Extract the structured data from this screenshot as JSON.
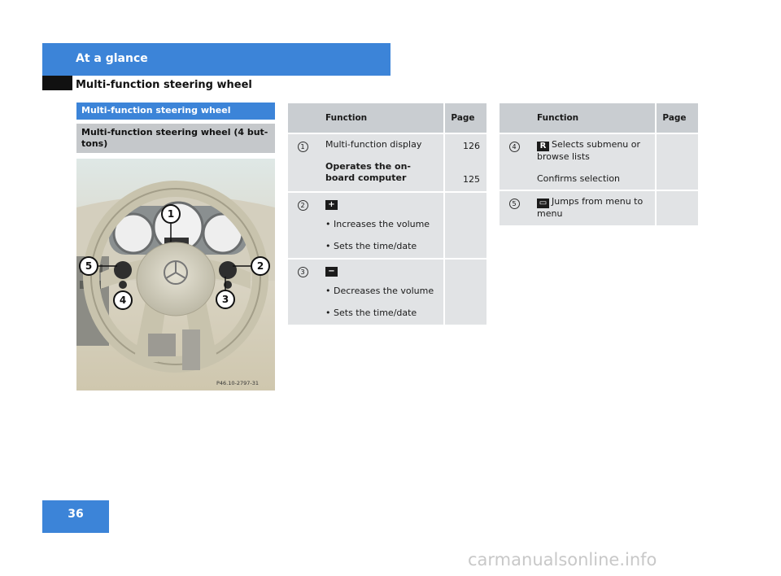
{
  "header": {
    "section": "At a glance",
    "subtitle": "Multi-function steering wheel"
  },
  "left": {
    "section_bar": "Multi-function steering wheel",
    "sub_bar": "Multi-function steering wheel (4 buttons)",
    "photo_code": "P46.10-2797-31",
    "callouts": [
      "1",
      "2",
      "3",
      "4",
      "5"
    ]
  },
  "table_headers": {
    "function": "Function",
    "page": "Page"
  },
  "table1": {
    "rows": [
      {
        "num": "1",
        "lines": [
          "Multi-function display",
          "Operates the on-board computer"
        ],
        "pages": [
          "126",
          "125"
        ]
      },
      {
        "num": "2",
        "key": "+",
        "bullets": [
          "Increases the volume",
          "Sets the time/date"
        ]
      },
      {
        "num": "3",
        "key": "−",
        "bullets": [
          "Decreases the volume",
          "Sets the time/date"
        ]
      }
    ]
  },
  "table2": {
    "rows": [
      {
        "num": "4",
        "key": "R",
        "text": "Selects submenu or browse lists",
        "text2": "Confirms selection"
      },
      {
        "num": "5",
        "key": "▭",
        "text": "Jumps from menu to menu"
      }
    ]
  },
  "page_number": "36",
  "watermark": "carmanualsonline.info",
  "colors": {
    "brand_blue": "#3c84d8",
    "header_gray": "#c9cdd1",
    "row_gray": "#e1e3e5"
  }
}
